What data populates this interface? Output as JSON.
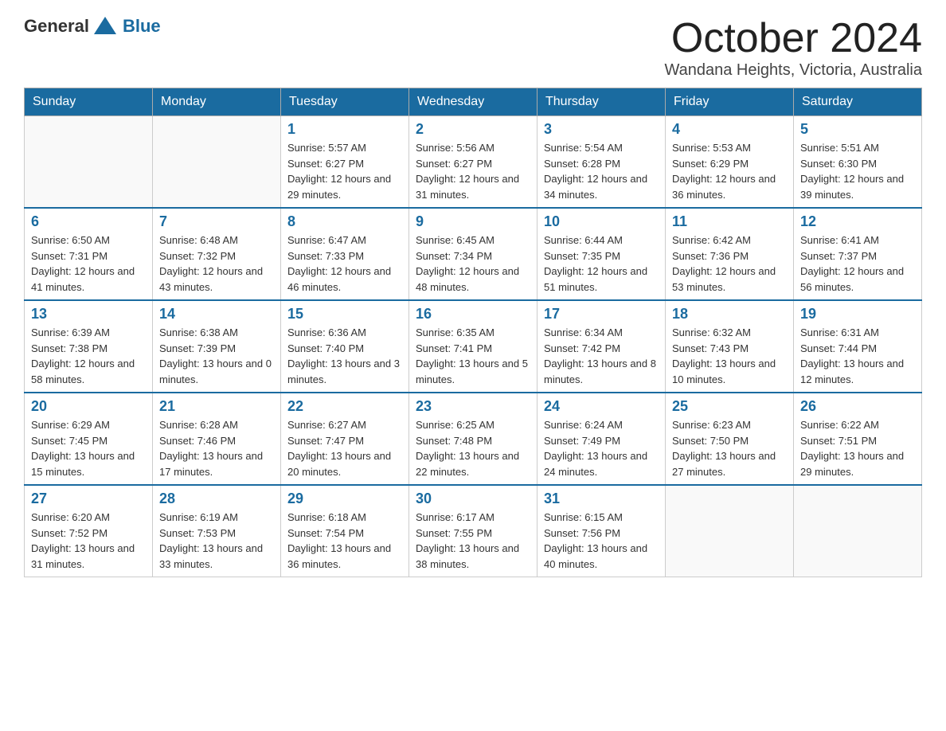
{
  "header": {
    "logo": {
      "general": "General",
      "blue": "Blue"
    },
    "month": "October 2024",
    "location": "Wandana Heights, Victoria, Australia"
  },
  "days_of_week": [
    "Sunday",
    "Monday",
    "Tuesday",
    "Wednesday",
    "Thursday",
    "Friday",
    "Saturday"
  ],
  "weeks": [
    [
      {
        "day": "",
        "sunrise": "",
        "sunset": "",
        "daylight": ""
      },
      {
        "day": "",
        "sunrise": "",
        "sunset": "",
        "daylight": ""
      },
      {
        "day": "1",
        "sunrise": "5:57 AM",
        "sunset": "6:27 PM",
        "daylight": "12 hours and 29 minutes."
      },
      {
        "day": "2",
        "sunrise": "5:56 AM",
        "sunset": "6:27 PM",
        "daylight": "12 hours and 31 minutes."
      },
      {
        "day": "3",
        "sunrise": "5:54 AM",
        "sunset": "6:28 PM",
        "daylight": "12 hours and 34 minutes."
      },
      {
        "day": "4",
        "sunrise": "5:53 AM",
        "sunset": "6:29 PM",
        "daylight": "12 hours and 36 minutes."
      },
      {
        "day": "5",
        "sunrise": "5:51 AM",
        "sunset": "6:30 PM",
        "daylight": "12 hours and 39 minutes."
      }
    ],
    [
      {
        "day": "6",
        "sunrise": "6:50 AM",
        "sunset": "7:31 PM",
        "daylight": "12 hours and 41 minutes."
      },
      {
        "day": "7",
        "sunrise": "6:48 AM",
        "sunset": "7:32 PM",
        "daylight": "12 hours and 43 minutes."
      },
      {
        "day": "8",
        "sunrise": "6:47 AM",
        "sunset": "7:33 PM",
        "daylight": "12 hours and 46 minutes."
      },
      {
        "day": "9",
        "sunrise": "6:45 AM",
        "sunset": "7:34 PM",
        "daylight": "12 hours and 48 minutes."
      },
      {
        "day": "10",
        "sunrise": "6:44 AM",
        "sunset": "7:35 PM",
        "daylight": "12 hours and 51 minutes."
      },
      {
        "day": "11",
        "sunrise": "6:42 AM",
        "sunset": "7:36 PM",
        "daylight": "12 hours and 53 minutes."
      },
      {
        "day": "12",
        "sunrise": "6:41 AM",
        "sunset": "7:37 PM",
        "daylight": "12 hours and 56 minutes."
      }
    ],
    [
      {
        "day": "13",
        "sunrise": "6:39 AM",
        "sunset": "7:38 PM",
        "daylight": "12 hours and 58 minutes."
      },
      {
        "day": "14",
        "sunrise": "6:38 AM",
        "sunset": "7:39 PM",
        "daylight": "13 hours and 0 minutes."
      },
      {
        "day": "15",
        "sunrise": "6:36 AM",
        "sunset": "7:40 PM",
        "daylight": "13 hours and 3 minutes."
      },
      {
        "day": "16",
        "sunrise": "6:35 AM",
        "sunset": "7:41 PM",
        "daylight": "13 hours and 5 minutes."
      },
      {
        "day": "17",
        "sunrise": "6:34 AM",
        "sunset": "7:42 PM",
        "daylight": "13 hours and 8 minutes."
      },
      {
        "day": "18",
        "sunrise": "6:32 AM",
        "sunset": "7:43 PM",
        "daylight": "13 hours and 10 minutes."
      },
      {
        "day": "19",
        "sunrise": "6:31 AM",
        "sunset": "7:44 PM",
        "daylight": "13 hours and 12 minutes."
      }
    ],
    [
      {
        "day": "20",
        "sunrise": "6:29 AM",
        "sunset": "7:45 PM",
        "daylight": "13 hours and 15 minutes."
      },
      {
        "day": "21",
        "sunrise": "6:28 AM",
        "sunset": "7:46 PM",
        "daylight": "13 hours and 17 minutes."
      },
      {
        "day": "22",
        "sunrise": "6:27 AM",
        "sunset": "7:47 PM",
        "daylight": "13 hours and 20 minutes."
      },
      {
        "day": "23",
        "sunrise": "6:25 AM",
        "sunset": "7:48 PM",
        "daylight": "13 hours and 22 minutes."
      },
      {
        "day": "24",
        "sunrise": "6:24 AM",
        "sunset": "7:49 PM",
        "daylight": "13 hours and 24 minutes."
      },
      {
        "day": "25",
        "sunrise": "6:23 AM",
        "sunset": "7:50 PM",
        "daylight": "13 hours and 27 minutes."
      },
      {
        "day": "26",
        "sunrise": "6:22 AM",
        "sunset": "7:51 PM",
        "daylight": "13 hours and 29 minutes."
      }
    ],
    [
      {
        "day": "27",
        "sunrise": "6:20 AM",
        "sunset": "7:52 PM",
        "daylight": "13 hours and 31 minutes."
      },
      {
        "day": "28",
        "sunrise": "6:19 AM",
        "sunset": "7:53 PM",
        "daylight": "13 hours and 33 minutes."
      },
      {
        "day": "29",
        "sunrise": "6:18 AM",
        "sunset": "7:54 PM",
        "daylight": "13 hours and 36 minutes."
      },
      {
        "day": "30",
        "sunrise": "6:17 AM",
        "sunset": "7:55 PM",
        "daylight": "13 hours and 38 minutes."
      },
      {
        "day": "31",
        "sunrise": "6:15 AM",
        "sunset": "7:56 PM",
        "daylight": "13 hours and 40 minutes."
      },
      {
        "day": "",
        "sunrise": "",
        "sunset": "",
        "daylight": ""
      },
      {
        "day": "",
        "sunrise": "",
        "sunset": "",
        "daylight": ""
      }
    ]
  ]
}
